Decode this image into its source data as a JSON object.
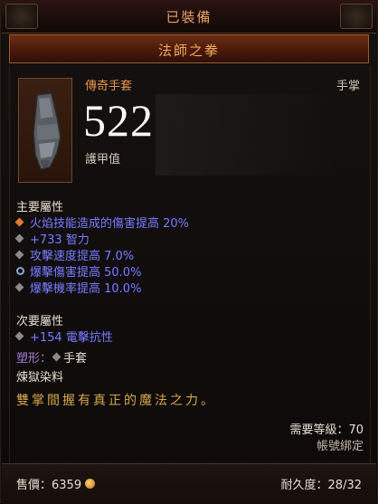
{
  "header": {
    "equipped_label": "已裝備"
  },
  "item": {
    "name": "法師之拳",
    "quality": "傳奇手套",
    "slot": "手掌",
    "armor_value": "522",
    "armor_label": "護甲值"
  },
  "primary": {
    "title": "主要屬性",
    "affixes": [
      {
        "text": "火焰技能造成的傷害提高 20%",
        "bullet": "orange"
      },
      {
        "text": "+733 智力",
        "bullet": "gray"
      },
      {
        "text": "攻擊速度提高 7.0%",
        "bullet": "gray"
      },
      {
        "text": "爆擊傷害提高 50.0%",
        "bullet": "swirl"
      },
      {
        "text": "爆擊機率提高 10.0%",
        "bullet": "gray"
      }
    ]
  },
  "secondary": {
    "title": "次要屬性",
    "affixes": [
      {
        "text": "+154 電擊抗性",
        "bullet": "gray"
      }
    ]
  },
  "transmog": {
    "label": "塑形：",
    "value": "手套"
  },
  "dye": {
    "label": "煉獄染料"
  },
  "flavor_text": "雙掌間握有真正的魔法之力。",
  "requirements": {
    "level_text": "需要等級：70",
    "bound_text": "帳號綁定"
  },
  "footer": {
    "price_text": "售價：6359",
    "durability_text": "耐久度：28/32"
  },
  "colors": {
    "legendary_orange": "#e8944a",
    "magic_blue": "#7a7cff",
    "flavor_gold": "#d6a64a"
  }
}
